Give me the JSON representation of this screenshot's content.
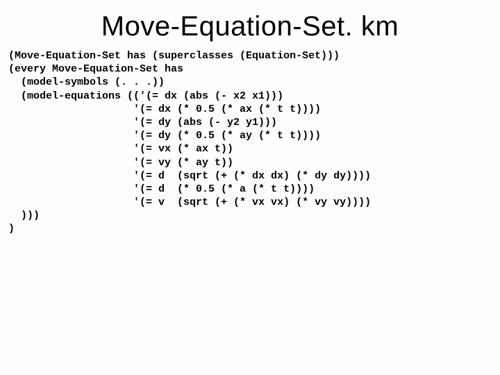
{
  "title": "Move-Equation-Set. km",
  "code": {
    "l01": "(Move-Equation-Set has (superclasses (Equation-Set)))",
    "l02": "(every Move-Equation-Set has",
    "l03": "  (model-symbols (. . .))",
    "l04": "  (model-equations (('(= dx (abs (- x2 x1)))",
    "l05": "                    '(= dx (* 0.5 (* ax (* t t))))",
    "l06": "                    '(= dy (abs (- y2 y1)))",
    "l07": "                    '(= dy (* 0.5 (* ay (* t t))))",
    "l08": "                    '(= vx (* ax t))",
    "l09": "                    '(= vy (* ay t))",
    "l10": "                    '(= d  (sqrt (+ (* dx dx) (* dy dy))))",
    "l11": "                    '(= d  (* 0.5 (* a (* t t))))",
    "l12": "                    '(= v  (sqrt (+ (* vx vx) (* vy vy))))",
    "l13": "  )))",
    "l14": ")"
  }
}
